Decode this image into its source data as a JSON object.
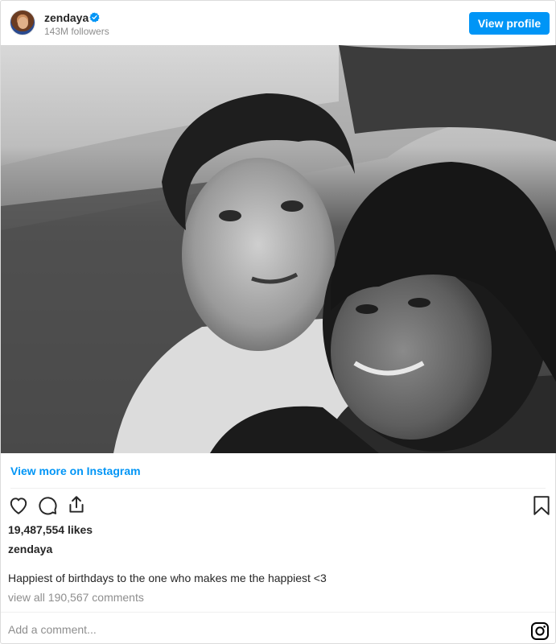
{
  "header": {
    "username": "zendaya",
    "followers": "143M followers",
    "view_profile_label": "View profile"
  },
  "post": {
    "photo_description_icon": "post-photo",
    "view_more_label": "View more on Instagram",
    "likes": "19,487,554 likes",
    "caption_username": "zendaya",
    "caption": "Happiest of birthdays to the one who makes me the happiest <3",
    "view_comments": "view all 190,567 comments",
    "add_comment_placeholder": "Add a comment..."
  },
  "icons": {
    "avatar": "avatar",
    "verified": "verified-badge-icon",
    "heart": "heart-icon",
    "comment": "comment-icon",
    "share": "share-icon",
    "bookmark": "bookmark-icon",
    "instagram": "instagram-logo-icon"
  },
  "colors": {
    "accent": "#0095f6",
    "text": "#262626",
    "muted": "#8e8e8e"
  }
}
